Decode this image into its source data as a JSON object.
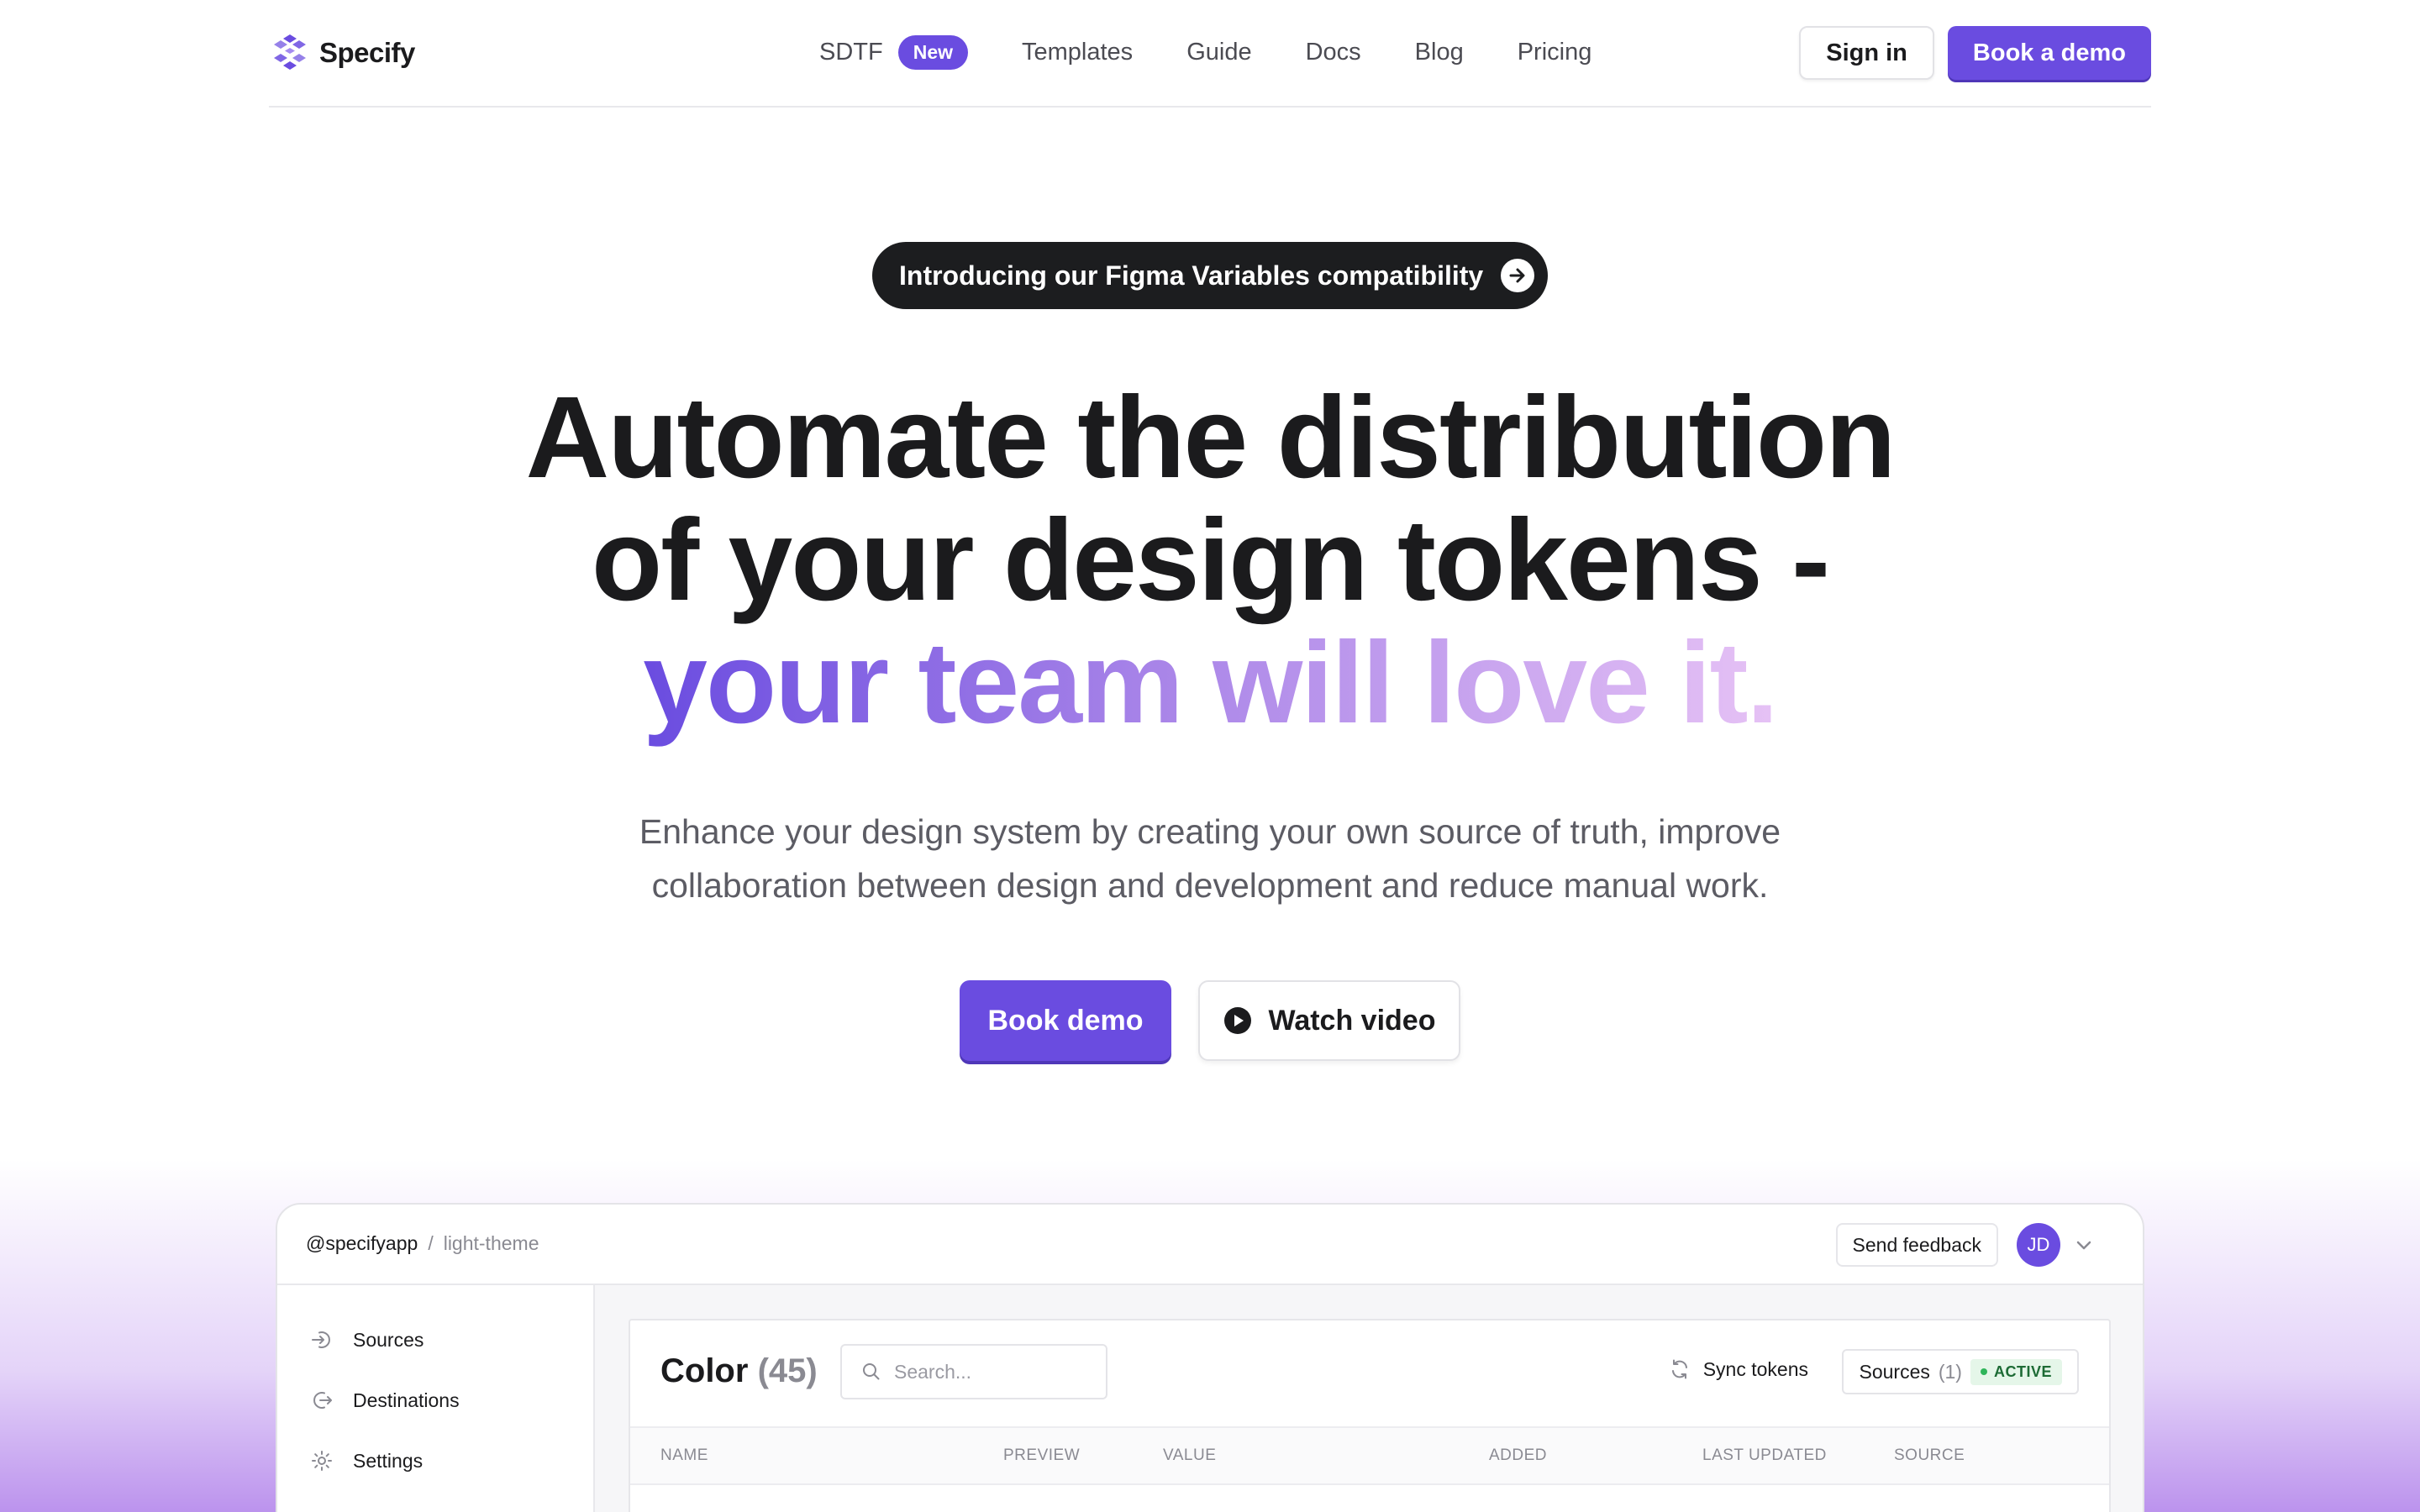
{
  "brand": {
    "name": "Specify"
  },
  "nav": {
    "items": [
      {
        "label": "SDTF",
        "badge": "New"
      },
      {
        "label": "Templates"
      },
      {
        "label": "Guide"
      },
      {
        "label": "Docs"
      },
      {
        "label": "Blog"
      },
      {
        "label": "Pricing"
      }
    ],
    "sign_in": "Sign in",
    "book_demo": "Book a demo"
  },
  "hero": {
    "announcement": "Introducing our Figma Variables compatibility",
    "headline_line1": "Automate the distribution",
    "headline_line2": "of your design tokens -",
    "headline_line3": "your team will love it.",
    "subtitle": "Enhance your design system by creating your own source of truth, improve collaboration between design and development and reduce manual work.",
    "cta_primary": "Book demo",
    "cta_secondary": "Watch video"
  },
  "app": {
    "breadcrumb": {
      "org": "@specifyapp",
      "separator": "/",
      "theme": "light-theme"
    },
    "send_feedback": "Send feedback",
    "avatar_initials": "JD",
    "sidebar": [
      {
        "label": "Sources",
        "icon": "sign-in-icon"
      },
      {
        "label": "Destinations",
        "icon": "sign-out-icon"
      },
      {
        "label": "Settings",
        "icon": "gear-icon"
      }
    ],
    "panel": {
      "title": "Color",
      "count": "(45)",
      "search_placeholder": "Search...",
      "sync_label": "Sync tokens",
      "sources_label": "Sources",
      "sources_count": "(1)",
      "status": "ACTIVE",
      "columns": [
        "NAME",
        "PREVIEW",
        "VALUE",
        "ADDED",
        "LAST UPDATED",
        "SOURCE"
      ]
    }
  },
  "colors": {
    "accent": "#6a4ce0",
    "dark": "#1c1d1f",
    "muted": "#5c5c64"
  }
}
